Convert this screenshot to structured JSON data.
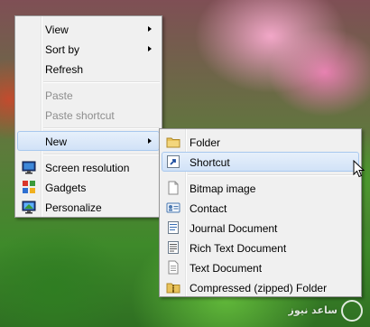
{
  "context_menu": {
    "items": [
      {
        "label": "View"
      },
      {
        "label": "Sort by"
      },
      {
        "label": "Refresh"
      },
      {
        "label": "Paste"
      },
      {
        "label": "Paste shortcut"
      },
      {
        "label": "New"
      },
      {
        "label": "Screen resolution"
      },
      {
        "label": "Gadgets"
      },
      {
        "label": "Personalize"
      }
    ]
  },
  "new_submenu": {
    "items": [
      {
        "label": "Folder",
        "icon": "folder-icon"
      },
      {
        "label": "Shortcut",
        "icon": "shortcut-icon"
      },
      {
        "label": "Bitmap image",
        "icon": "bitmap-image-icon"
      },
      {
        "label": "Contact",
        "icon": "contact-icon"
      },
      {
        "label": "Journal Document",
        "icon": "journal-document-icon"
      },
      {
        "label": "Rich Text Document",
        "icon": "rich-text-document-icon"
      },
      {
        "label": "Text Document",
        "icon": "text-document-icon"
      },
      {
        "label": "Compressed (zipped) Folder",
        "icon": "zipped-folder-icon"
      }
    ]
  },
  "watermark": {
    "text": "ساعد نیوز"
  },
  "colors": {
    "highlight_border": "#a8c8ee",
    "highlight_fill": "#d1e2f7",
    "menu_bg": "#f0f0f0"
  }
}
